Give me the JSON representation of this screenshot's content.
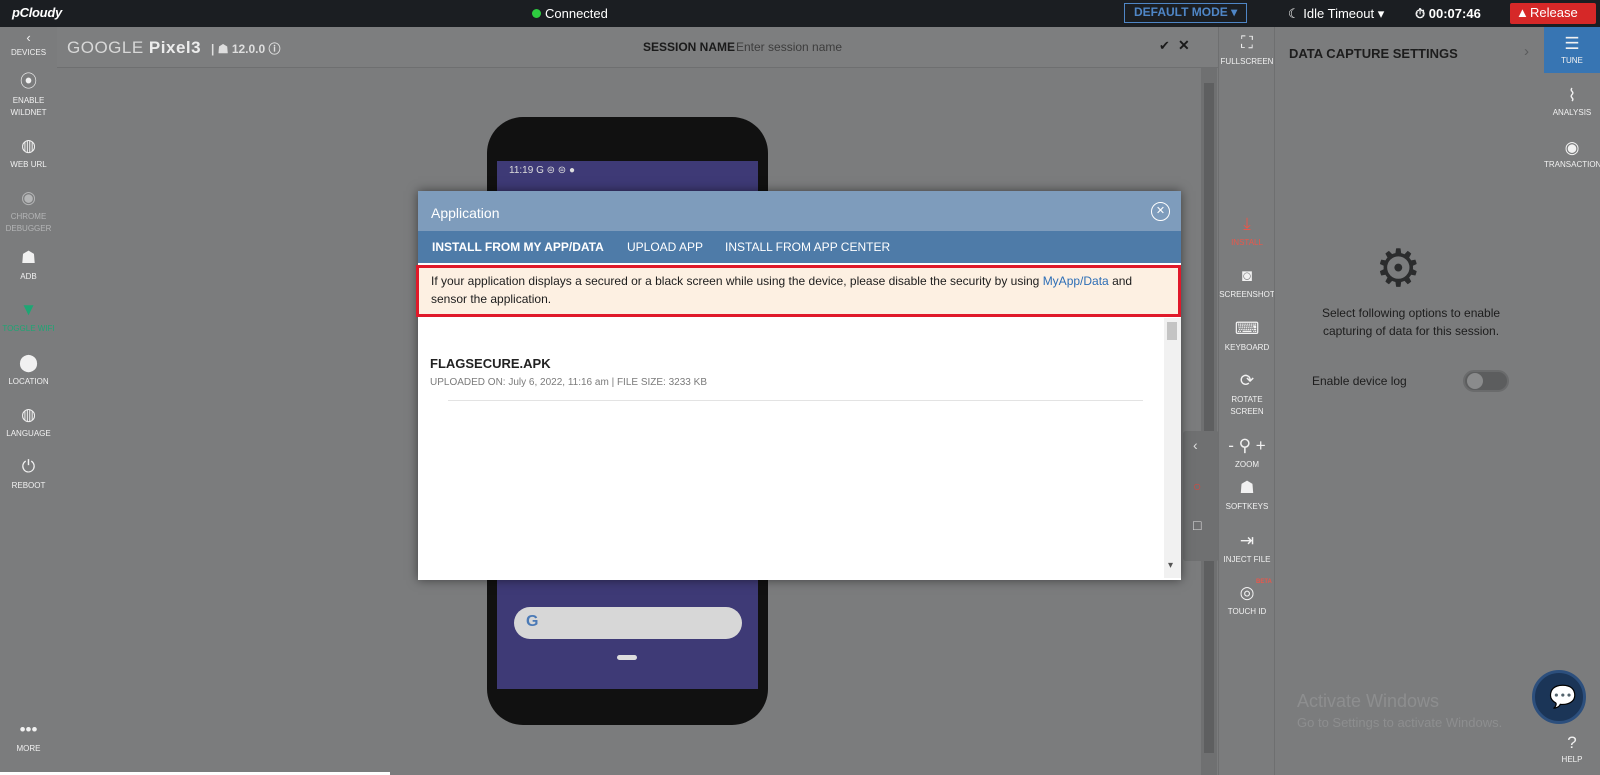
{
  "topbar": {
    "logo": "pCloudy",
    "status": "Connected",
    "mode_label": "DEFAULT MODE",
    "idle_timeout": "Idle Timeout",
    "timer": "00:07:46",
    "release": "Release"
  },
  "leftnav": {
    "items": [
      {
        "label": "DEVICES",
        "icon": "chevron-left-icon"
      },
      {
        "label": "ENABLE WILDNET",
        "icon": "antenna-icon"
      },
      {
        "label": "WEB URL",
        "icon": "globe-icon"
      },
      {
        "label": "CHROME DEBUGGER",
        "icon": "chrome-icon"
      },
      {
        "label": "ADB",
        "icon": "android-icon"
      },
      {
        "label": "TOGGLE WIFI",
        "icon": "wifi-icon"
      },
      {
        "label": "LOCATION",
        "icon": "location-pin-icon"
      },
      {
        "label": "LANGUAGE",
        "icon": "globe-icon"
      },
      {
        "label": "REBOOT",
        "icon": "power-icon"
      },
      {
        "label": "MORE",
        "icon": "more-icon"
      }
    ]
  },
  "device": {
    "brand": "GOOGLE",
    "model": "Pixel3",
    "version": "12.0.0",
    "session_name_label": "SESSION NAME",
    "session_placeholder": "Enter session name",
    "status_time": "11:19"
  },
  "rightbar": {
    "items": [
      {
        "label": "FULLSCREEN",
        "icon": "fullscreen-icon"
      },
      {
        "label": "INSTALL",
        "icon": "download-icon"
      },
      {
        "label": "SCREENSHOT",
        "icon": "camera-icon"
      },
      {
        "label": "KEYBOARD",
        "icon": "keyboard-icon"
      },
      {
        "label": "ROTATE SCREEN",
        "icon": "rotate-icon"
      },
      {
        "label": "ZOOM",
        "icon": "zoom-icon"
      },
      {
        "label": "SOFTKEYS",
        "icon": "android-icon"
      },
      {
        "label": "INJECT FILE",
        "icon": "inject-file-icon"
      },
      {
        "label": "TOUCH ID",
        "icon": "fingerprint-icon"
      }
    ],
    "beta": "BETA"
  },
  "panel": {
    "title": "DATA CAPTURE SETTINGS",
    "description": "Select following options to enable capturing of data for this session.",
    "device_log_label": "Enable device log",
    "device_log_enabled": false,
    "watermark_title": "Activate Windows",
    "watermark_sub": "Go to Settings to activate Windows."
  },
  "rtabs": {
    "items": [
      {
        "label": "TUNE",
        "icon": "tune-icon"
      },
      {
        "label": "ANALYSIS",
        "icon": "analysis-icon"
      },
      {
        "label": "TRANSACTION",
        "icon": "transaction-icon"
      },
      {
        "label": "HELP",
        "icon": "help-icon"
      }
    ]
  },
  "modal": {
    "title": "Application",
    "tabs": [
      "INSTALL FROM MY APP/DATA",
      "UPLOAD APP",
      "INSTALL FROM APP CENTER"
    ],
    "alert_text_1": "If your application displays a secured or a black screen while using the device, please disable the security by using",
    "alert_link": "MyApp/Data",
    "alert_text_2": "and sensor the application.",
    "files": [
      {
        "name": "FLAGSECURE.APK",
        "meta": "UPLOADED ON: July 6, 2022, 11:16 am | FILE SIZE: 3233 KB"
      }
    ]
  }
}
